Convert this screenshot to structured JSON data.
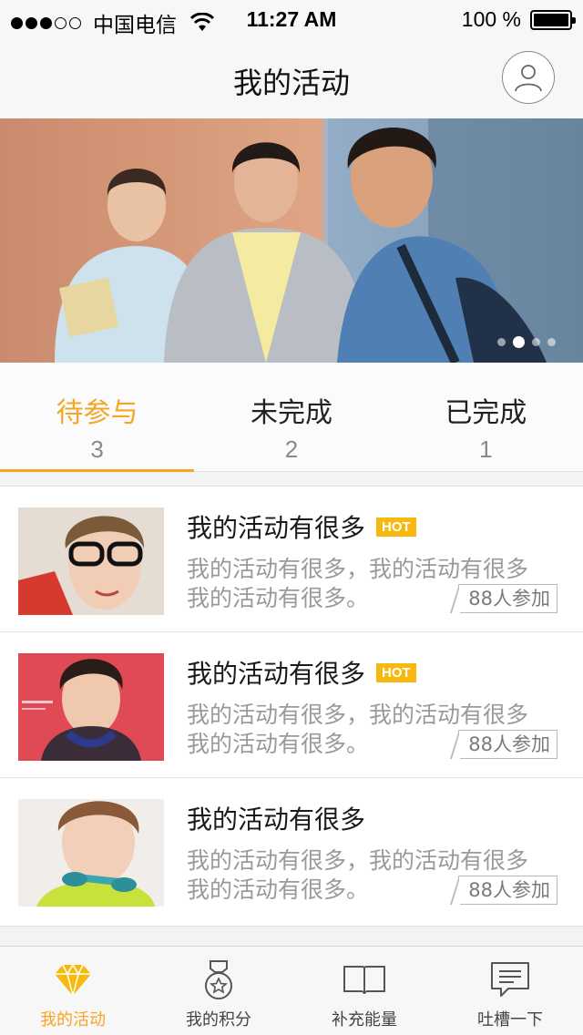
{
  "status_bar": {
    "carrier": "中国电信",
    "time": "11:27 AM",
    "battery": "100 %"
  },
  "nav": {
    "title": "我的活动"
  },
  "banner": {
    "slide_count": 4,
    "active_slide": 2
  },
  "tabs": [
    {
      "label": "待参与",
      "count": "3",
      "active": true
    },
    {
      "label": "未完成",
      "count": "2",
      "active": false
    },
    {
      "label": "已完成",
      "count": "1",
      "active": false
    }
  ],
  "activities": [
    {
      "title": "我的活动有很多",
      "hot": "HOT",
      "desc_line1": "我的活动有很多，我的活动有很多",
      "desc_line2": "我的活动有很多。",
      "participants": "88人参加"
    },
    {
      "title": "我的活动有很多",
      "hot": "HOT",
      "desc_line1": "我的活动有很多，我的活动有很多",
      "desc_line2": "我的活动有很多。",
      "participants": "88人参加"
    },
    {
      "title": "我的活动有很多",
      "hot": "",
      "desc_line1": "我的活动有很多，我的活动有很多",
      "desc_line2": "我的活动有很多。",
      "participants": "88人参加"
    }
  ],
  "tab_bar": [
    {
      "label": "我的活动",
      "icon": "diamond-icon",
      "active": true
    },
    {
      "label": "我的积分",
      "icon": "medal-icon",
      "active": false
    },
    {
      "label": "补充能量",
      "icon": "book-icon",
      "active": false
    },
    {
      "label": "吐槽一下",
      "icon": "chat-icon",
      "active": false
    }
  ],
  "colors": {
    "accent": "#f5a623",
    "hot_badge": "#f7b90f"
  }
}
